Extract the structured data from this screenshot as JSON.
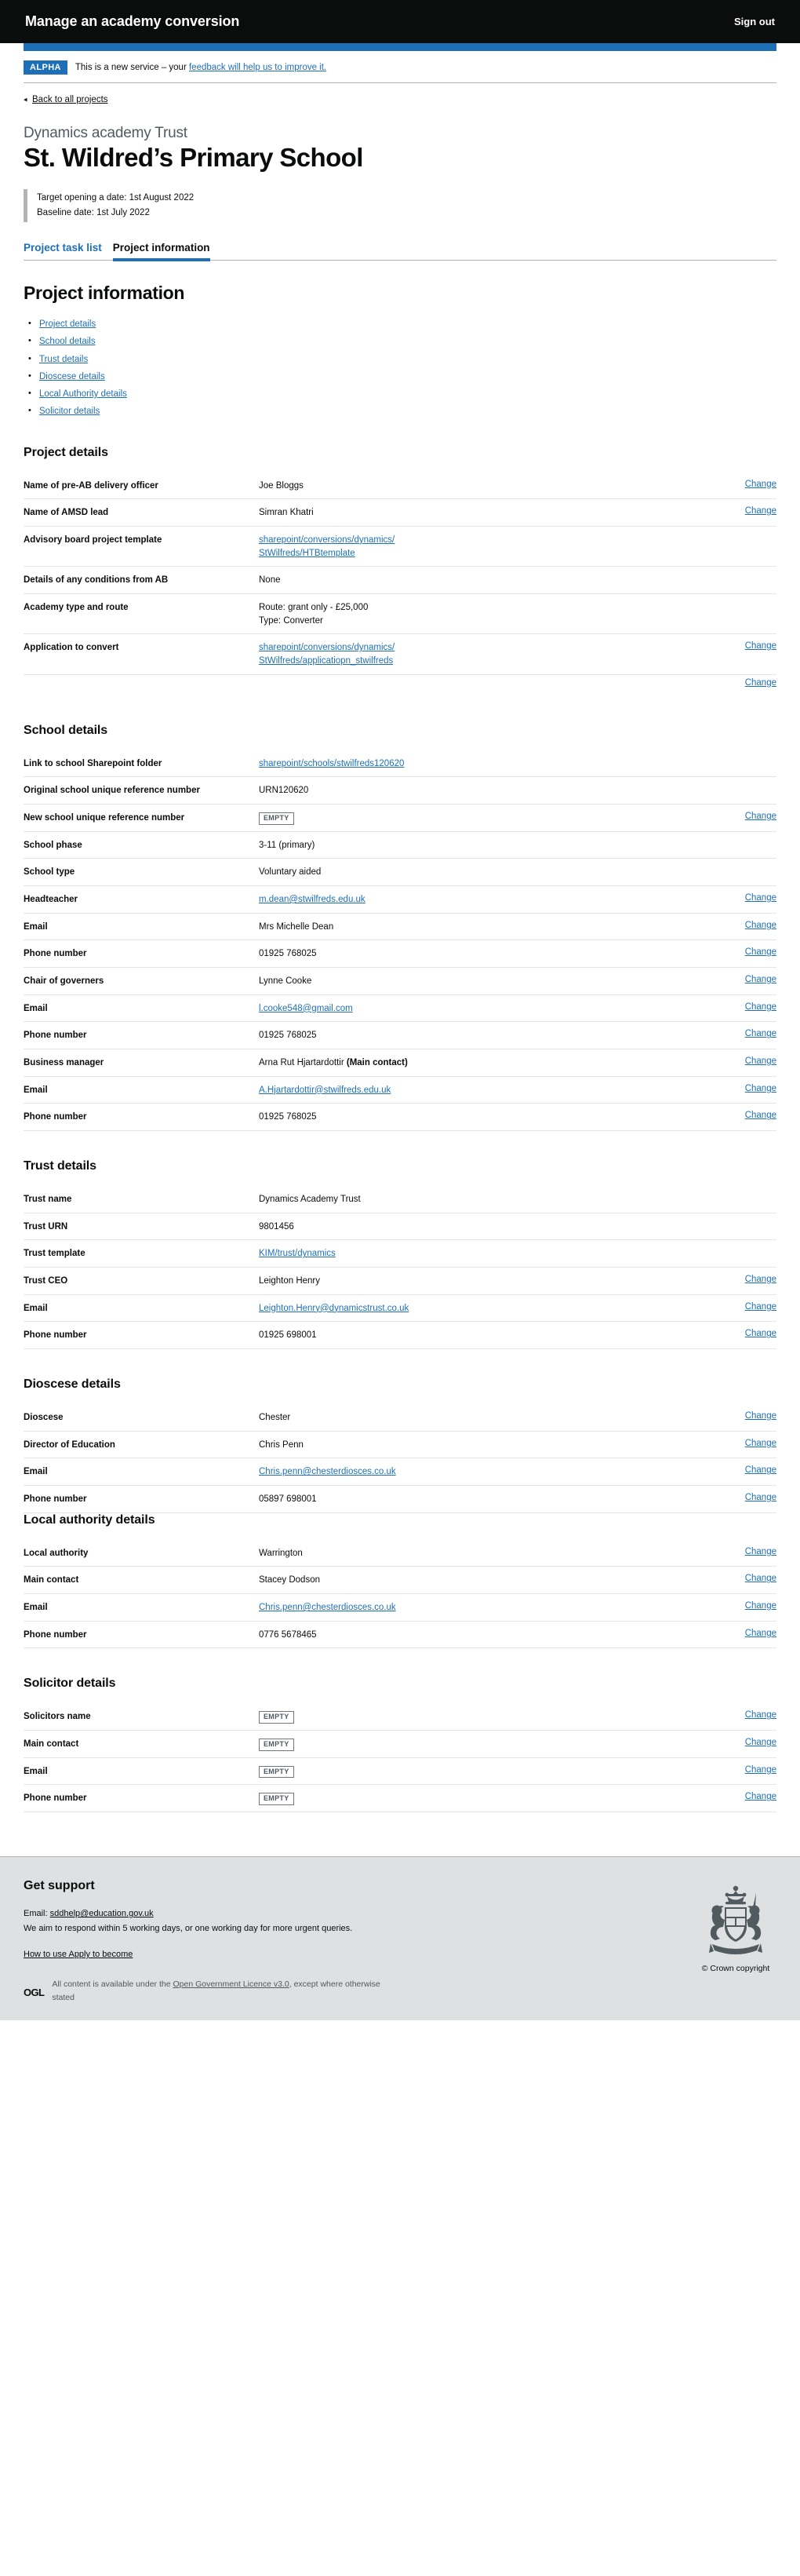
{
  "header": {
    "service_name": "Manage an academy conversion",
    "sign_out": "Sign out"
  },
  "phase_banner": {
    "tag": "ALPHA",
    "text_before": "This is a new service – your ",
    "link": "feedback will help us to improve it."
  },
  "back_link": {
    "label": "Back to all projects",
    "arrow": "◂"
  },
  "title": {
    "caption": "Dynamics academy Trust",
    "heading": "St. Wildred’s Primary School"
  },
  "inset": {
    "target_date": "Target opening a date: 1st August 2022",
    "baseline_date": "Baseline date: 1st July 2022"
  },
  "tabs": [
    {
      "label": "Project task list",
      "selected": false
    },
    {
      "label": "Project information",
      "selected": true
    }
  ],
  "page": {
    "section_title": "Project information"
  },
  "contents": [
    "Project details",
    "School details",
    "Trust details",
    "Dioscese details",
    "Local Authority details",
    "Solicitor details"
  ],
  "change_label": "Change",
  "empty_label": "EMPTY",
  "sections": {
    "project_details": {
      "heading": "Project details",
      "rows": [
        {
          "key": "Name of pre-AB delivery officer",
          "value": "Joe Bloggs",
          "action": "Change"
        },
        {
          "key": "Name of AMSD lead",
          "value": "Simran Khatri",
          "action": "Change"
        },
        {
          "key": "Advisory board project template",
          "value_lines": [
            "sharepoint/conversions/dynamics/",
            "StWilfreds/HTBtemplate"
          ],
          "link": true,
          "action": ""
        },
        {
          "key": "Details of any conditions from AB",
          "value": "None",
          "action": ""
        },
        {
          "key": "Academy type and route",
          "value_lines": [
            "Route: grant only - £25,000",
            "Type: Converter"
          ],
          "action": ""
        },
        {
          "key": "Application to convert",
          "value_lines": [
            "sharepoint/conversions/dynamics/",
            "StWilfreds/applicatiopn_stwilfreds"
          ],
          "link": true,
          "action": "Change"
        },
        {
          "key": "",
          "value": "",
          "action": "Change",
          "lone": true
        }
      ]
    },
    "school_details": {
      "heading": "School details",
      "rows": [
        {
          "key": "Link to school Sharepoint folder",
          "value": "sharepoint/schools/stwilfreds120620",
          "link": true,
          "action": ""
        },
        {
          "key": "Original school unique reference number",
          "value": "URN120620",
          "action": ""
        },
        {
          "key": "New school unique reference number",
          "value": "EMPTY",
          "empty": true,
          "action": "Change"
        },
        {
          "key": "School phase",
          "value": "3-11 (primary)",
          "action": ""
        },
        {
          "key": "School type",
          "value": "Voluntary aided",
          "action": ""
        },
        {
          "key": "Headteacher",
          "value": "m.dean@stwilfreds.edu.uk",
          "link": true,
          "action": "Change"
        },
        {
          "key": "Email",
          "value": "Mrs Michelle Dean",
          "action": "Change"
        },
        {
          "key": "Phone number",
          "value": "01925 768025",
          "action": "Change"
        },
        {
          "key": "Chair of governers",
          "value": "Lynne Cooke",
          "action": "Change"
        },
        {
          "key": "Email",
          "value": "l.cooke548@gmail.com",
          "link": true,
          "action": "Change"
        },
        {
          "key": "Phone number",
          "value": "01925 768025",
          "action": "Change"
        },
        {
          "key": "Business manager",
          "value": "Arna Rut Hjartardottir ",
          "bold_suffix": "(Main contact)",
          "action": "Change"
        },
        {
          "key": "Email",
          "value": "A.Hjartardottir@stwilfreds.edu.uk",
          "link": true,
          "action": "Change"
        },
        {
          "key": "Phone number",
          "value": "01925 768025",
          "action": "Change"
        }
      ]
    },
    "trust_details": {
      "heading": "Trust details",
      "rows": [
        {
          "key": "Trust name",
          "value": "Dynamics Academy Trust",
          "action": ""
        },
        {
          "key": "Trust URN",
          "value": "9801456",
          "action": ""
        },
        {
          "key": "Trust template",
          "value": "KIM/trust/dynamics",
          "link": true,
          "action": ""
        },
        {
          "key": "Trust CEO",
          "value": "Leighton Henry",
          "action": "Change"
        },
        {
          "key": "Email",
          "value": "Leighton.Henry@dynamicstrust.co.uk",
          "link": true,
          "action": "Change"
        },
        {
          "key": "Phone number",
          "value": "01925 698001",
          "action": "Change"
        }
      ]
    },
    "dioscese_details": {
      "heading": "Dioscese details",
      "rows": [
        {
          "key": "Dioscese",
          "value": "Chester",
          "action": "Change"
        },
        {
          "key": "Director of Education",
          "value": "Chris Penn",
          "action": "Change"
        },
        {
          "key": "Email",
          "value": "Chris.penn@chesterdiosces.co.uk",
          "link": true,
          "action": "Change"
        },
        {
          "key": "Phone number",
          "value": "05897 698001",
          "action": "Change"
        }
      ]
    },
    "local_authority_details": {
      "heading": "Local authority details",
      "rows": [
        {
          "key": "Local authority",
          "value": "Warrington",
          "action": "Change"
        },
        {
          "key": "Main contact",
          "value": "Stacey Dodson",
          "action": "Change"
        },
        {
          "key": "Email",
          "value": "Chris.penn@chesterdiosces.co.uk",
          "link": true,
          "action": "Change"
        },
        {
          "key": "Phone number",
          "value": "0776 5678465",
          "action": "Change"
        }
      ]
    },
    "solicitor_details": {
      "heading": "Solicitor details",
      "rows": [
        {
          "key": "Solicitors name",
          "value": "EMPTY",
          "empty": true,
          "action": "Change"
        },
        {
          "key": "Main contact",
          "value": "EMPTY",
          "empty": true,
          "action": "Change"
        },
        {
          "key": "Email",
          "value": "EMPTY",
          "empty": true,
          "action": "Change"
        },
        {
          "key": "Phone number",
          "value": "EMPTY",
          "empty": true,
          "action": "Change"
        }
      ]
    }
  },
  "footer": {
    "heading": "Get support",
    "email_prefix": "Email: ",
    "email": "sddhelp@education.gov.uk",
    "response_text": "We aim to respond within 5 working days, or one working day for more urgent queries.",
    "how_to_link": "How to use Apply to become",
    "ogl_logo": "OGL",
    "ogl_before": "All content is available under the ",
    "ogl_link": "Open Government Licence v3.0",
    "ogl_after": ", except where otherwise stated",
    "crown_copyright": "© Crown copyright"
  },
  "colors": {
    "brand_blue": "#1d70b8",
    "black": "#0b0c0c",
    "footer_grey": "#dee0e2",
    "border_grey": "#b1b4b6"
  }
}
